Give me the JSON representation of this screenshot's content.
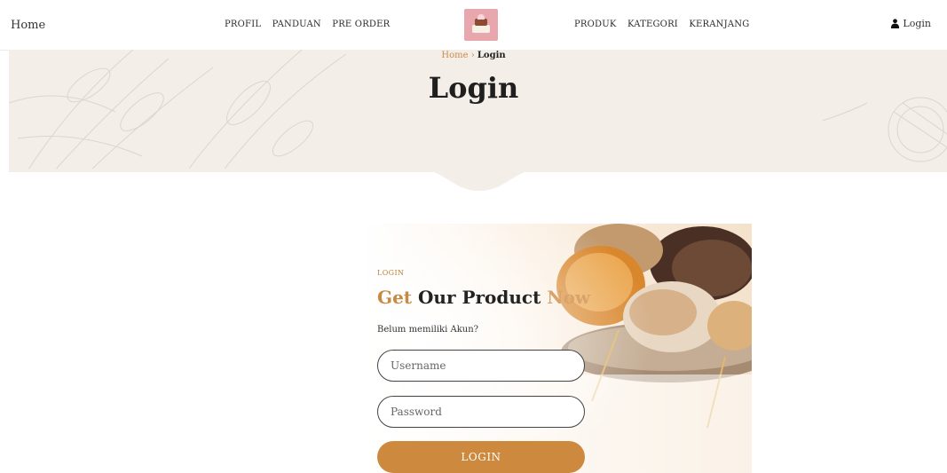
{
  "nav": {
    "brand": "Home",
    "left_items": [
      "PROFIL",
      "PANDUAN",
      "PRE ORDER"
    ],
    "right_items": [
      "PRODUK",
      "KATEGORI",
      "KERANJANG"
    ],
    "login_label": "Login",
    "login_icon": "user-icon"
  },
  "breadcrumb": {
    "home": "Home",
    "separator": "›",
    "current": "Login"
  },
  "hero": {
    "title": "Login"
  },
  "login_card": {
    "kicker": "LOGIN",
    "headline_part1": "Get",
    "headline_part2": " Our Product ",
    "headline_part3": "Now",
    "subtext": "Belum memiliki Akun?",
    "username_placeholder": "Username",
    "password_placeholder": "Password",
    "button_label": "LOGIN"
  },
  "colors": {
    "accent": "#cd8a3f",
    "hero_bg": "#f3eee8"
  }
}
